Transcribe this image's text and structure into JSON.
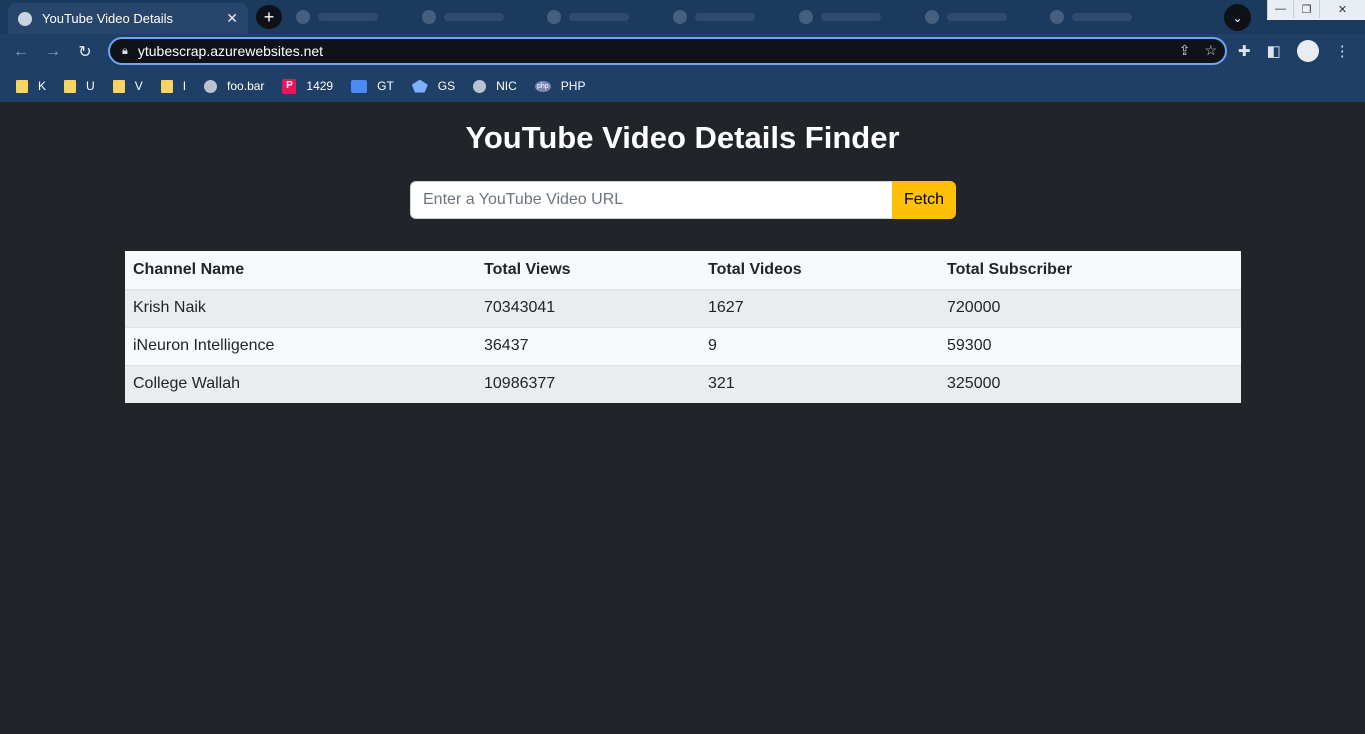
{
  "browser": {
    "active_tab_title": "YouTube Video Details",
    "url": "ytubescrap.azurewebsites.net",
    "bookmarks": [
      {
        "label": "K",
        "icon": "folder-icon"
      },
      {
        "label": "U",
        "icon": "folder-icon"
      },
      {
        "label": "V",
        "icon": "folder-icon"
      },
      {
        "label": "I",
        "icon": "folder-icon"
      },
      {
        "label": "foo.bar",
        "icon": "globe-icon"
      },
      {
        "label": "1429",
        "icon": "p-logo-icon"
      },
      {
        "label": "GT",
        "icon": "translate-icon"
      },
      {
        "label": "GS",
        "icon": "scholar-icon"
      },
      {
        "label": "NIC",
        "icon": "globe-icon"
      },
      {
        "label": "PHP",
        "icon": "php-icon"
      }
    ]
  },
  "page": {
    "title": "YouTube Video Details Finder",
    "search": {
      "placeholder": "Enter a YouTube Video URL",
      "value": "",
      "button_label": "Fetch"
    },
    "table": {
      "headers": [
        "Channel Name",
        "Total Views",
        "Total Videos",
        "Total Subscriber"
      ],
      "rows": [
        [
          "Krish Naik",
          "70343041",
          "1627",
          "720000"
        ],
        [
          "iNeuron Intelligence",
          "36437",
          "9",
          "59300"
        ],
        [
          "College Wallah",
          "10986377",
          "321",
          "325000"
        ]
      ]
    }
  },
  "colors": {
    "page_background": "#212529",
    "fetch_button": "#ffc107",
    "browser_chrome": "#1f3f66"
  }
}
